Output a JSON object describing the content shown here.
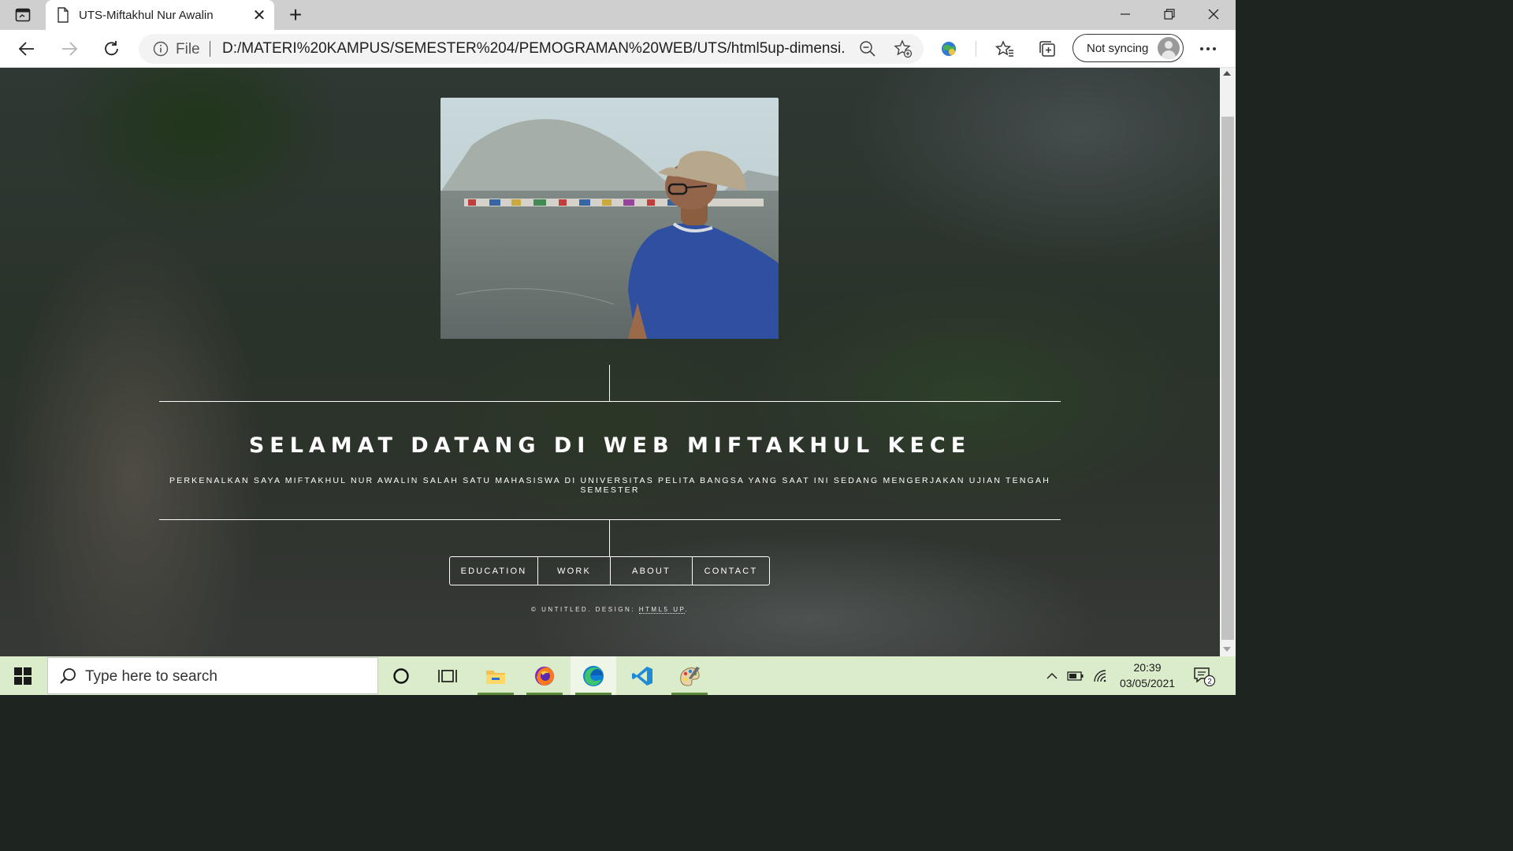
{
  "browser": {
    "tab_title": "UTS-Miftakhul Nur Awalin",
    "tab_close": "✕",
    "new_tab": "+",
    "address_scheme": "File",
    "url": "D:/MATERI%20KAMPUS/SEMESTER%204/PEMOGRAMAN%20WEB/UTS/html5up-dimensi...",
    "sync_label": "Not syncing",
    "icons": [
      "tab-actions-icon",
      "page-icon",
      "back-icon",
      "forward-icon",
      "refresh-icon",
      "info-icon",
      "zoom-out-icon",
      "add-favorite-icon",
      "extension-icon",
      "favorites-icon",
      "collections-icon",
      "more-icon",
      "minimize-icon",
      "restore-icon",
      "close-window-icon"
    ]
  },
  "page": {
    "title": "SELAMAT DATANG DI WEB MIFTAKHUL KECE",
    "subtitle": "PERKENALKAN SAYA MIFTAKHUL NUR AWALIN SALAH SATU MAHASISWA DI UNIVERSITAS PELITA BANGSA YANG SAAT INI SEDANG MENGERJAKAN UJIAN TENGAH SEMESTER",
    "nav": [
      {
        "label": "EDUCATION"
      },
      {
        "label": "WORK"
      },
      {
        "label": "ABOUT"
      },
      {
        "label": "CONTACT"
      }
    ],
    "footer_prefix": "© UNTITLED. DESIGN: ",
    "footer_link": "HTML5 UP",
    "footer_suffix": "."
  },
  "taskbar": {
    "search_placeholder": "Type here to search",
    "apps": [
      "cortana-icon",
      "task-view-icon",
      "file-explorer-icon",
      "firefox-icon",
      "edge-icon",
      "vscode-icon",
      "paint-icon"
    ],
    "time": "20:39",
    "date": "03/05/2021",
    "notification_count": "2"
  },
  "colors": {
    "taskbar_bg": "#dbeccb",
    "tabstrip_bg": "#cfcfcf",
    "page_text": "#ffffff"
  }
}
